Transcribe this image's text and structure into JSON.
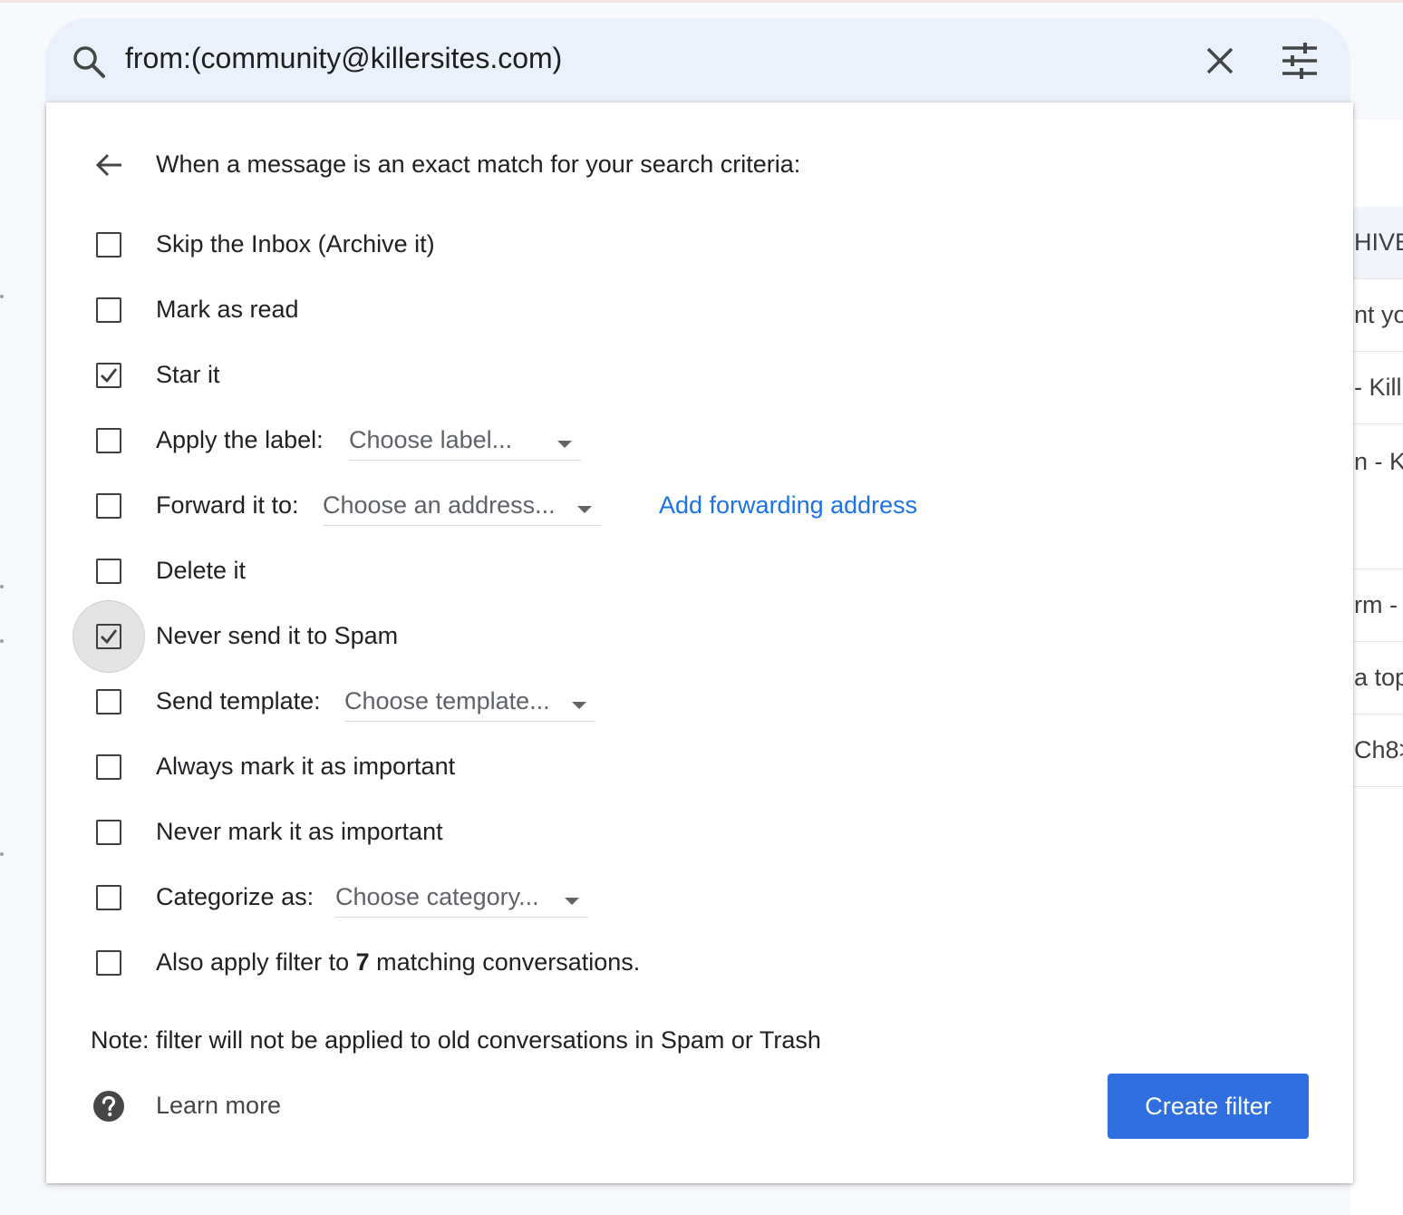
{
  "search": {
    "query": "from:(community@killersites.com)"
  },
  "filter": {
    "header": "When a message is an exact match for your search criteria:",
    "options": {
      "skip_inbox": {
        "label": "Skip the Inbox (Archive it)",
        "checked": false
      },
      "mark_read": {
        "label": "Mark as read",
        "checked": false
      },
      "star": {
        "label": "Star it",
        "checked": true
      },
      "apply_label": {
        "label": "Apply the label:",
        "select": "Choose label...",
        "checked": false
      },
      "forward": {
        "label": "Forward it to:",
        "select": "Choose an address...",
        "link": "Add forwarding address",
        "checked": false
      },
      "delete": {
        "label": "Delete it",
        "checked": false
      },
      "never_spam": {
        "label": "Never send it to Spam",
        "checked": true,
        "focused": true
      },
      "send_template": {
        "label": "Send template:",
        "select": "Choose template...",
        "checked": false
      },
      "always_important": {
        "label": "Always mark it as important",
        "checked": false
      },
      "never_important": {
        "label": "Never mark it as important",
        "checked": false
      },
      "categorize": {
        "label": "Categorize as:",
        "select": "Choose category...",
        "checked": false
      },
      "also_apply": {
        "label_prefix": "Also apply filter to ",
        "count": "7",
        "label_suffix": " matching conversations.",
        "checked": false
      }
    },
    "note": "Note: filter will not be applied to old conversations in Spam or Trash",
    "learn_more": "Learn more",
    "create_button": "Create filter"
  },
  "background": {
    "rows": [
      "HIVE",
      "nt yo",
      "- Kill",
      "n - K",
      "rm -",
      "a top",
      "Ch8>"
    ]
  },
  "colors": {
    "accent": "#2f6fdf",
    "link": "#1a73e8",
    "search_bg": "#eaf1fb"
  }
}
